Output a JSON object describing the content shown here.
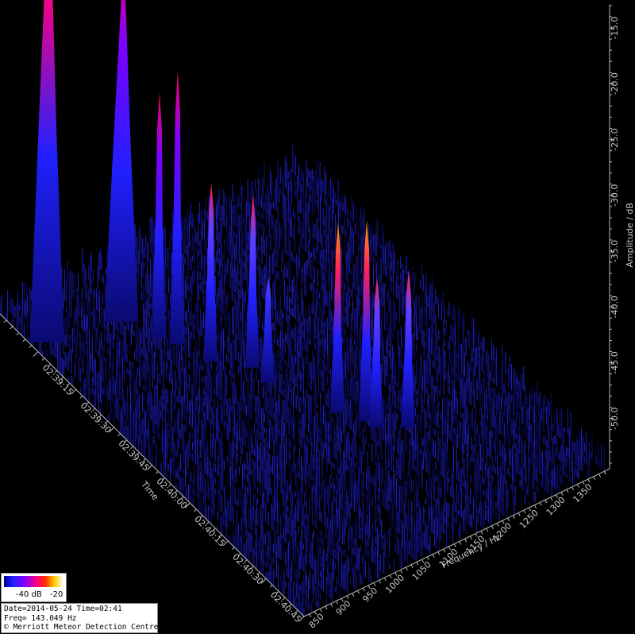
{
  "chart_data": {
    "type": "3d-spectrogram",
    "title": "",
    "time_axis": {
      "label": "Time",
      "ticks": [
        "02:39:15",
        "02:39:30",
        "02:39:45",
        "02:40:00",
        "02:40:15",
        "02:40:30",
        "02:40:45"
      ]
    },
    "frequency_axis": {
      "label": "Frequency / Hz",
      "ticks": [
        850,
        900,
        950,
        1000,
        1050,
        1100,
        1150,
        1200,
        1250,
        1300,
        1350
      ]
    },
    "amplitude_axis": {
      "label": "Amplitude / dB",
      "ticks": [
        "-15.0",
        "-20.0",
        "-25.0",
        "-30.0",
        "-35.0",
        "-40.0",
        "-45.0",
        "-50.0"
      ],
      "range": [
        -55,
        -12.5
      ]
    },
    "noise_floor_db": -52,
    "peaks": [
      {
        "time": "02:38:59",
        "freq_hz": 840,
        "amplitude_db": -13.0
      },
      {
        "time": "02:39:03",
        "freq_hz": 960,
        "amplitude_db": -21.5
      },
      {
        "time": "02:39:12",
        "freq_hz": 985,
        "amplitude_db": -33.0
      },
      {
        "time": "02:39:16",
        "freq_hz": 1000,
        "amplitude_db": -30.5
      },
      {
        "time": "02:39:25",
        "freq_hz": 1020,
        "amplitude_db": -39.0
      },
      {
        "time": "02:39:32",
        "freq_hz": 1065,
        "amplitude_db": -39.5
      },
      {
        "time": "02:39:38",
        "freq_hz": 1065,
        "amplitude_db": -45.5
      },
      {
        "time": "02:39:55",
        "freq_hz": 1115,
        "amplitude_db": -38.0
      },
      {
        "time": "02:40:01",
        "freq_hz": 1140,
        "amplitude_db": -37.0
      },
      {
        "time": "02:40:04",
        "freq_hz": 1145,
        "amplitude_db": -41.5
      },
      {
        "time": "02:40:08",
        "freq_hz": 1185,
        "amplitude_db": -41.0
      }
    ],
    "colorbar": {
      "labels": [
        "-40 dB",
        "-20"
      ],
      "colors": [
        "#0000a0",
        "#2020ff",
        "#8000ff",
        "#ff0080",
        "#ff3000",
        "#ffd000",
        "#ffffff"
      ]
    }
  },
  "info": {
    "date_time": "Date=2014-05-24 Time=02:41",
    "freq": "Freq= 143.049 Hz",
    "credit": "© Merriott Meteor Detection Centre"
  }
}
